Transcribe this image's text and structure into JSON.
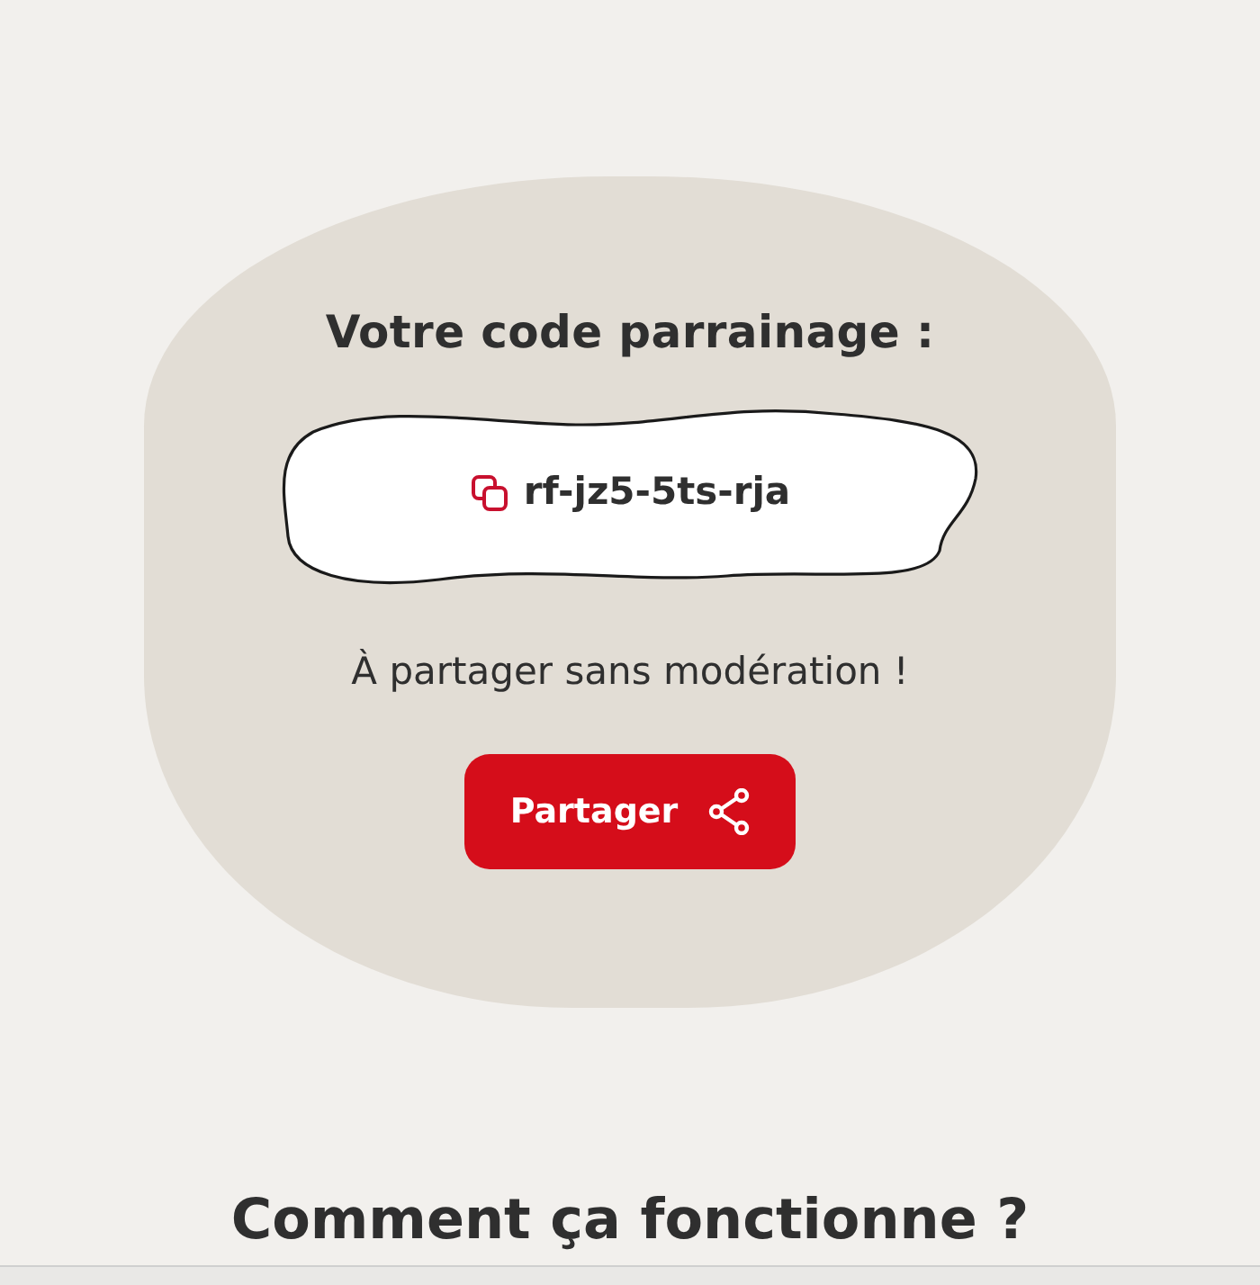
{
  "referral": {
    "title": "Votre code parrainage :",
    "code": "rf-jz5-5ts-rja",
    "subtitle": "À partager sans modération !",
    "share_button": "Partager"
  },
  "next_section": {
    "heading": "Comment ça fonctionne ?"
  }
}
